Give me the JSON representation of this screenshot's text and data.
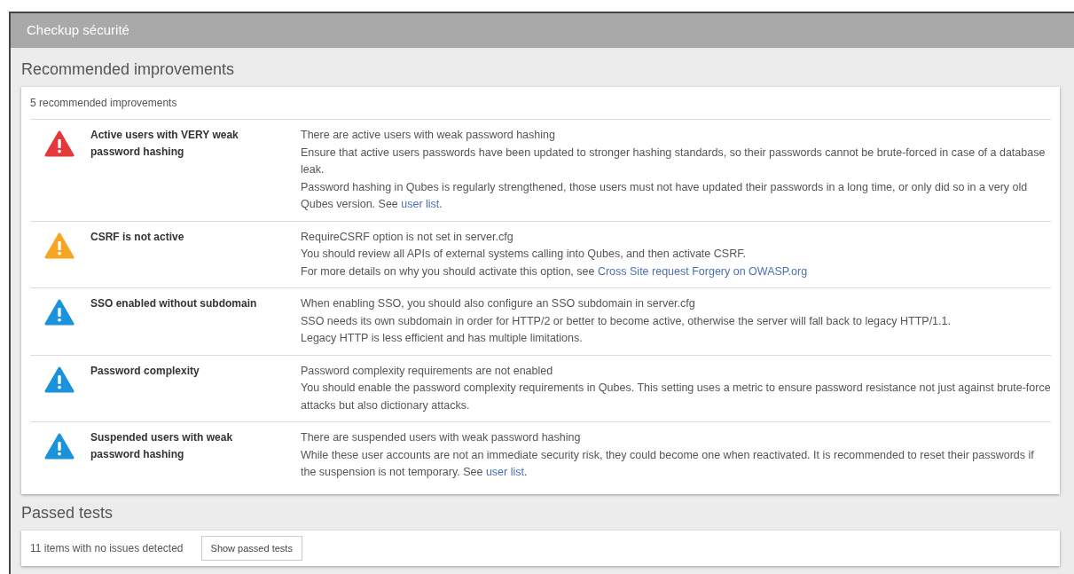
{
  "window": {
    "title": "Checkup sécurité"
  },
  "recommended": {
    "heading": "Recommended improvements",
    "summary": "5 recommended improvements",
    "items": [
      {
        "color": "#e5383b",
        "title": "Active users with VERY weak password hashing",
        "lines": [
          [
            {
              "kind": "text",
              "text": "There are active users with weak password hashing"
            }
          ],
          [
            {
              "kind": "text",
              "text": "Ensure that active users passwords have been updated to stronger hashing standards, so their passwords cannot be brute-forced in case of a database leak."
            }
          ],
          [
            {
              "kind": "text",
              "text": "Password hashing in Qubes is regularly strengthened, those users must not have updated their passwords in a long time, or only did so in a very old Qubes version. See "
            },
            {
              "kind": "link",
              "text": "user list"
            },
            {
              "kind": "text",
              "text": "."
            }
          ]
        ]
      },
      {
        "color": "#f5a623",
        "title": "CSRF is not active",
        "lines": [
          [
            {
              "kind": "text",
              "text": "RequireCSRF option is not set in server.cfg"
            }
          ],
          [
            {
              "kind": "text",
              "text": "You should review all APIs of external systems calling into Qubes, and then activate CSRF."
            }
          ],
          [
            {
              "kind": "text",
              "text": "For more details on why you should activate this option, see "
            },
            {
              "kind": "link",
              "text": "Cross Site request Forgery on OWASP.org"
            }
          ]
        ]
      },
      {
        "color": "#1a93dc",
        "title": "SSO enabled without subdomain",
        "lines": [
          [
            {
              "kind": "text",
              "text": "When enabling SSO, you should also configure an SSO subdomain in server.cfg"
            }
          ],
          [
            {
              "kind": "text",
              "text": "SSO needs its own subdomain in order for HTTP/2 or better to become active, otherwise the server will fall back to legacy HTTP/1.1."
            }
          ],
          [
            {
              "kind": "text",
              "text": "Legacy HTTP is less efficient and has multiple limitations."
            }
          ]
        ]
      },
      {
        "color": "#1a93dc",
        "title": "Password complexity",
        "lines": [
          [
            {
              "kind": "text",
              "text": "Password complexity requirements are not enabled"
            }
          ],
          [
            {
              "kind": "text",
              "text": "You should enable the password complexity requirements in Qubes. This setting uses a metric to ensure password resistance not just against brute-force attacks but also dictionary attacks."
            }
          ]
        ]
      },
      {
        "color": "#1a93dc",
        "title": "Suspended users with weak password hashing",
        "lines": [
          [
            {
              "kind": "text",
              "text": "There are suspended users with weak password hashing"
            }
          ],
          [
            {
              "kind": "text",
              "text": "While these user accounts are not an immediate security risk, they could become one when reactivated. It is recommended to reset their passwords if the suspension is not temporary. See "
            },
            {
              "kind": "link",
              "text": "user list"
            },
            {
              "kind": "text",
              "text": "."
            }
          ]
        ]
      }
    ]
  },
  "passed": {
    "heading": "Passed tests",
    "summary": "11 items with no issues detected",
    "button": "Show passed tests"
  }
}
